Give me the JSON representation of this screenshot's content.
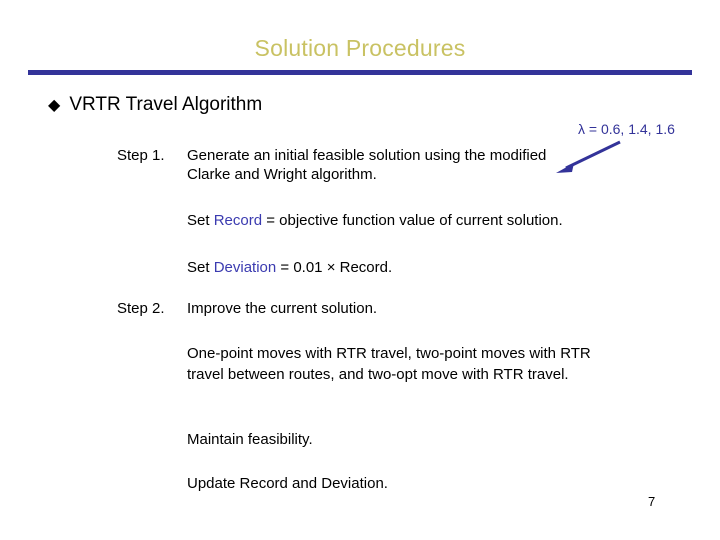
{
  "slide": {
    "title": "Solution Procedures",
    "page_number": "7",
    "rule_color": "#333399",
    "title_color": "#c9c263",
    "keyword_color": "#3b3bb0",
    "annotation_color": "#333399"
  },
  "bullet": {
    "glyph": "◆",
    "glyph_name": "diamond-bullet-icon",
    "label": "VRTR Travel Algorithm"
  },
  "annotation": {
    "lambda_note": "λ = 0.6, 1.4, 1.6",
    "arrow_name": "callout-arrow-icon"
  },
  "steps": [
    {
      "label": "Step 1.",
      "text": "Generate an initial feasible solution using the modified Clarke and Wright algorithm."
    },
    {
      "label": "Step 2.",
      "text": "Improve the current solution."
    }
  ],
  "set_record": {
    "prefix": "Set ",
    "keyword": "Record",
    "suffix": " = objective function value of current solution."
  },
  "set_deviation": {
    "prefix": "Set ",
    "keyword": "Deviation",
    "suffix": " = 0.01 × Record."
  },
  "moves_paragraph": "One-point moves with RTR travel, two-point moves with RTR travel between routes, and two-opt move with RTR travel.",
  "maintain_line": "Maintain feasibility.",
  "update_line": "Update Record and Deviation."
}
